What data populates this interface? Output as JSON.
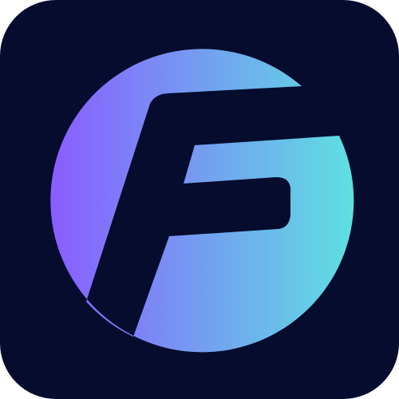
{
  "icon": {
    "name": "app-logo-icon",
    "glyph": "F",
    "colors": {
      "background": "#050C2E",
      "gradient_start": "#8A5CFF",
      "gradient_end": "#5EE0E2"
    }
  }
}
